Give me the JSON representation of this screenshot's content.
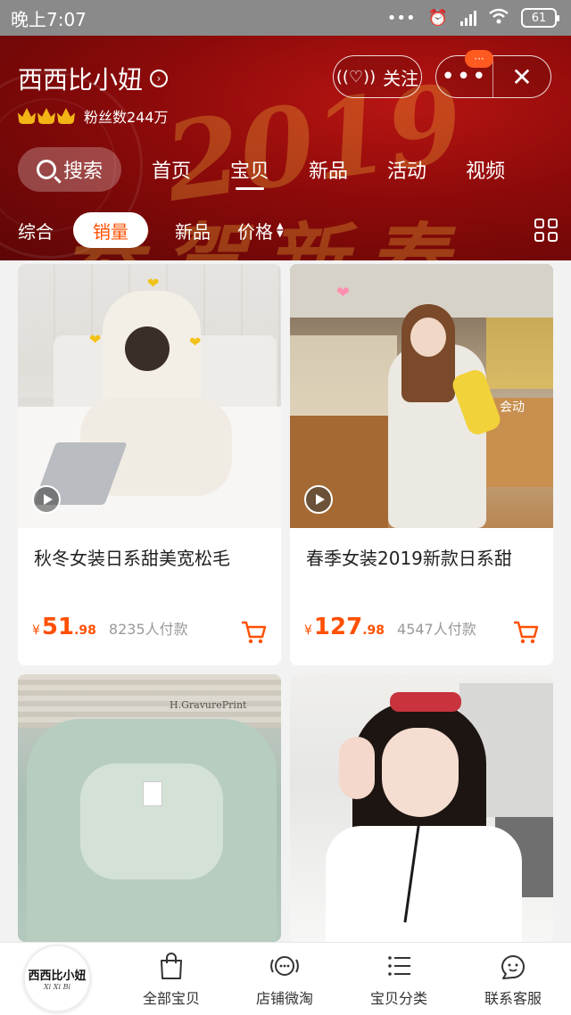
{
  "status_bar": {
    "time": "晚上7:07",
    "icons": [
      "dots-icon",
      "alarm-icon",
      "signal-icon",
      "wifi-icon"
    ],
    "battery": "61"
  },
  "shop": {
    "name": "西西比小妞",
    "fans": "粉丝数244万",
    "crown_count": 3,
    "follow_label": "关注",
    "more_badge": "···"
  },
  "nav_tabs": {
    "search_label": "搜索",
    "tabs": [
      "首页",
      "宝贝",
      "新品",
      "活动",
      "视频"
    ],
    "active_index": 1
  },
  "sort_bar": {
    "items": [
      "综合",
      "销量",
      "新品",
      "价格"
    ],
    "active_index": 1
  },
  "products": [
    {
      "title": "秋冬女装日系甜美宽松毛",
      "currency": "¥",
      "price_int": "51",
      "price_dec": ".98",
      "sold": "8235人付款",
      "has_video": true
    },
    {
      "title": "春季女装2019新款日系甜",
      "currency": "¥",
      "price_int": "127",
      "price_dec": ".98",
      "sold": "4547人付款",
      "has_video": true
    },
    {
      "image_text": "H.GravurePrint"
    },
    {}
  ],
  "bottom_nav": {
    "logo_main": "西西比小妞",
    "logo_sub": "Xi Xi Bi",
    "items": [
      "全部宝贝",
      "店铺微淘",
      "宝贝分类",
      "联系客服"
    ]
  },
  "colors": {
    "accent": "#ff5000",
    "header_bg": "#8c0a0a",
    "crown": "#f3b416"
  }
}
